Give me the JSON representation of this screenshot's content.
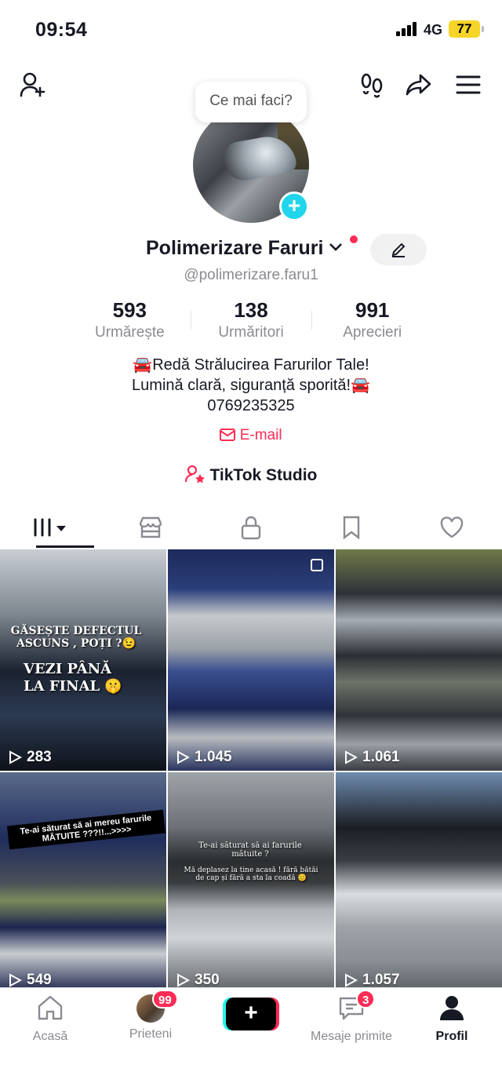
{
  "status": {
    "time": "09:54",
    "network": "4G",
    "battery": "77"
  },
  "tooltip": {
    "text": "Ce mai faci?"
  },
  "profile": {
    "name": "Polimerizare Faruri",
    "handle": "@polimerizare.faru1",
    "stats": [
      {
        "value": "593",
        "label": "Urmărește"
      },
      {
        "value": "138",
        "label": "Urmăritori"
      },
      {
        "value": "991",
        "label": "Aprecieri"
      }
    ],
    "bio_lines": [
      "🚘Redă Strălucirea Farurilor Tale!",
      "Lumină clară, siguranță sporită!🚘",
      "0769235325"
    ],
    "email_label": "E-mail",
    "studio_label": "TikTok Studio"
  },
  "videos": [
    {
      "views": "283",
      "caption1": "GĂSEȘTE DEFECTUL ASCUNS , POȚI ?😉",
      "caption2": "VEZI PÂNĂ LA FINAL 🤫"
    },
    {
      "views": "1.045"
    },
    {
      "views": "1.061"
    },
    {
      "views": "549",
      "caption1": "Te-ai săturat să ai mereu farurile MĂTUITE ???!!...>>>>"
    },
    {
      "views": "350",
      "caption1": "Te-ai săturat să ai farurile mătuite ?",
      "caption2": "Mă deplasez la tine acasă ! fără bătăi de cap și fără a sta la coadă 😊"
    },
    {
      "views": "1.057"
    }
  ],
  "nav": {
    "home": "Acasă",
    "friends": "Prieteni",
    "friends_badge": "99",
    "inbox": "Mesaje primite",
    "inbox_badge": "3",
    "profile": "Profil"
  },
  "colors": {
    "accent": "#fe2c55",
    "cyan": "#25f4ee",
    "text": "#161823",
    "muted": "#8a8b91"
  }
}
